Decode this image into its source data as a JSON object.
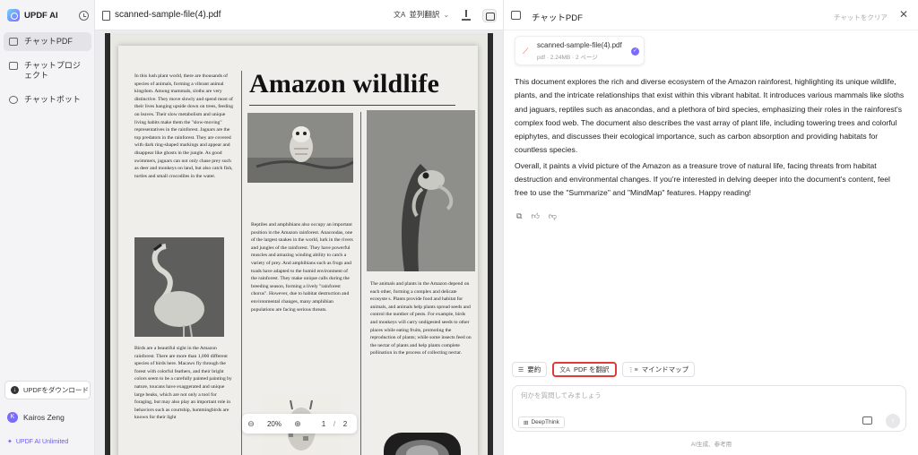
{
  "app": {
    "name": "UPDF AI"
  },
  "sidebar": {
    "items": [
      {
        "label": "チャットPDF",
        "icon": "chat-pdf-icon",
        "active": true
      },
      {
        "label": "チャットプロジェクト",
        "icon": "folder-icon",
        "active": false
      },
      {
        "label": "チャットボット",
        "icon": "bot-icon",
        "active": false
      }
    ],
    "download_label": "UPDFをダウンロード",
    "user_name": "Kairos Zeng",
    "user_initial": "K",
    "plan_label": "UPDF AI Unlimited"
  },
  "viewer": {
    "file_name": "scanned-sample-file(4).pdf",
    "translate_label": "並列翻訳",
    "zoom": "20%",
    "current_page": "1",
    "total_pages": "2",
    "page": {
      "title": "Amazon wildlife",
      "col1_top": "In this lush plant world, there are thousands of species of animals, forming a vibrant animal kingdom. Among mammals, sloths are very distinctive. They move slowly and spend most of their lives hanging upside down on trees, feeding on leaves. Their slow metabolism and unique living habits make them the \"slow-moving\" representatives in the rainforest. Jaguars are the top predators in the rainforest. They are covered with dark ring-shaped markings and appear and disappear like ghosts in the jungle. As good swimmers, jaguars can not only chase prey such as deer and monkeys on land, but also catch fish, turtles and small crocodiles in the water.",
      "col1_bottom": "Birds are a beautiful sight in the Amazon rainforest. There are more than 1,000 different species of birds here. Macaws fly through the forest with colorful feathers, and their bright colors seem to be a carefully painted painting by nature, toucans have exaggerated and unique large beaks, which are not only a tool for foraging, but may also play an important role in behaviors such as courtship, hummingbirds are known for their light",
      "col2": "Reptiles and amphibians also occupy an important position in the Amazon rainforest. Anacondas, one of the largest snakes in the world, lurk in the rivers and jungles of the rainforest. They have powerful muscles and amazing winding ability to catch a variety of prey. And amphibians such as frogs and toads have adapted to the humid environment of the rainforest. They make unique calls during the breeding season, forming a lively \"rainforest chorus\". However, due to habitat destruction and environmental changes, many amphibian populations are facing serious threats.",
      "col3": "The animals and plants in the Amazon depend on each other, forming a complex and delicate ecosyste s. Plants provide food and habitat for animals, and animals help plants spread seeds and control the number of pests. For example, birds and monkeys will carry undigested seeds to other places while eating fruits, promoting the reproduction of plants; while some insects feed on the nectar of plants and help plants complete pollination in the process of collecting nectar."
    }
  },
  "chat": {
    "title": "チャットPDF",
    "clear_label": "チャットをクリア",
    "file_card": {
      "name": "scanned-sample-file(4).pdf",
      "meta": "pdf · 2.24MB · 2 ページ"
    },
    "answer_paragraphs": [
      "This document explores the rich and diverse ecosystem of the Amazon rainforest, highlighting its unique wildlife, plants, and the intricate relationships that exist within this vibrant habitat. It introduces various mammals like sloths and jaguars, reptiles such as anacondas, and a plethora of bird species, emphasizing their roles in the rainforest's complex food web. The document also describes the vast array of plant life, including towering trees and colorful epiphytes, and discusses their ecological importance, such as carbon absorption and providing habitats for countless species.",
      "Overall, it paints a vivid picture of the Amazon as a treasure trove of natural life, facing threats from habitat destruction and environmental changes. If you're interested in delving deeper into the document's content, feel free to use the \"Summarize\" and \"MindMap\" features. Happy reading!"
    ],
    "actions": [
      "copy-icon",
      "thumbs-up-icon",
      "thumbs-down-icon"
    ],
    "chips": [
      {
        "label": "要約",
        "icon": "summary-icon",
        "highlighted": false
      },
      {
        "label": "PDF を翻訳",
        "icon": "translate-icon",
        "highlighted": true
      },
      {
        "label": "マインドマップ",
        "icon": "mindmap-icon",
        "highlighted": false
      }
    ],
    "input_placeholder": "何かを質問してみましょう",
    "deepthink_label": "DeepThink",
    "footer": "AI生成、参考用"
  },
  "colors": {
    "accent": "#7a6bff",
    "highlight": "#e03a3a",
    "pdf_red": "#e05a4e"
  }
}
